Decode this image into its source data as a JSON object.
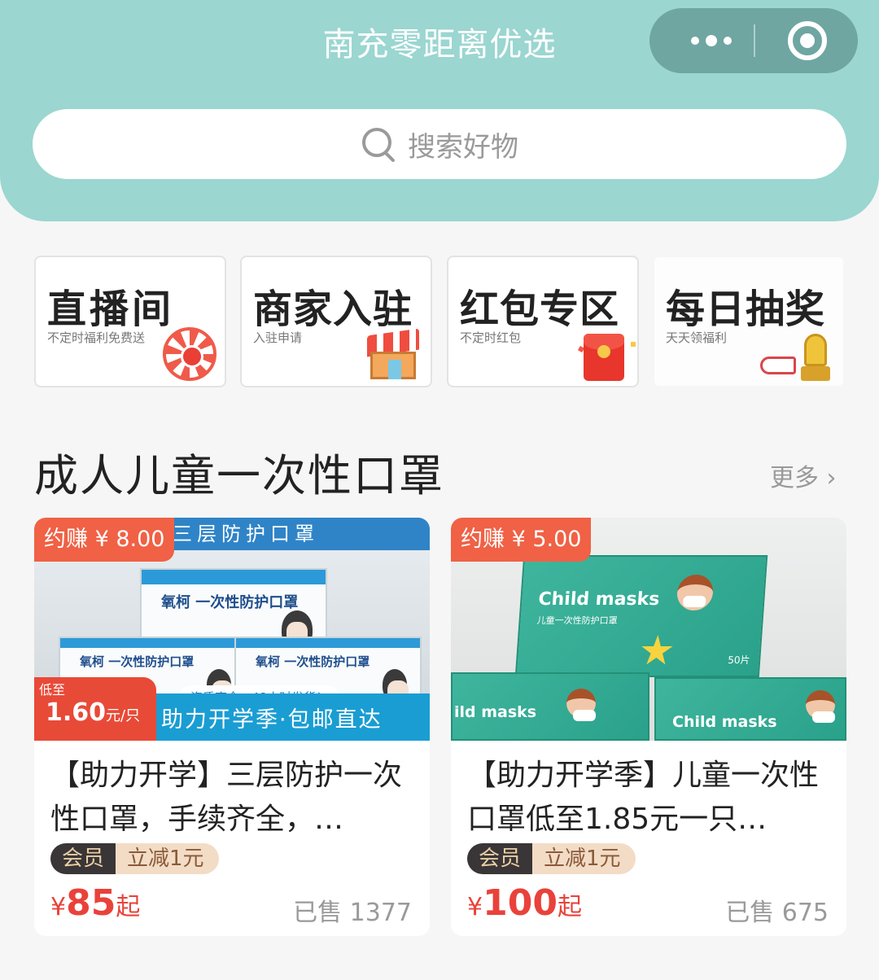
{
  "header": {
    "title": "南充零距离优选",
    "menu_icon": "more-dots-icon",
    "close_icon": "target-circle-icon",
    "search_placeholder": "搜索好物"
  },
  "entries": [
    {
      "title": "直播间",
      "subtitle": "不定时福利免费送",
      "icon": "live-wheel-icon"
    },
    {
      "title": "商家入驻",
      "subtitle": "入驻申请",
      "icon": "shop-icon"
    },
    {
      "title": "红包专区",
      "subtitle": "不定时红包",
      "icon": "red-packet-icon"
    },
    {
      "title": "每日抽奖",
      "subtitle": "天天领福利",
      "icon": "prize-icon"
    }
  ],
  "section": {
    "title": "成人儿童一次性口罩",
    "more_label": "更多",
    "more_icon": "chevron-right-icon"
  },
  "products": [
    {
      "earn_badge": "约赚 ¥ 8.00",
      "photo": {
        "banner": "三层防护口罩",
        "box_text": "一次性防护口罩",
        "box_brand": "氧柯",
        "lowest_label": "低至",
        "lowest_price": "1.60",
        "lowest_unit": "元/只",
        "note": "资质齐全，48小时发货！",
        "slogan": "助力开学季·包邮直达"
      },
      "name": "【助力开学】三层防护一次性口罩，手续齐全，…",
      "tag_member": "会员",
      "tag_discount": "立减1元",
      "price_currency": "¥",
      "price_value": "85",
      "price_suffix": "起",
      "sold": "已售 1377"
    },
    {
      "earn_badge": "约赚 ¥ 5.00",
      "photo": {
        "box_title": "Child masks",
        "box_sub": "儿童一次性防护口罩",
        "box_count": "50片",
        "box_title_2": "ild masks",
        "box_title_3": "Child masks"
      },
      "name": "【助力开学季】儿童一次性口罩低至1.85元一只…",
      "tag_member": "会员",
      "tag_discount": "立减1元",
      "price_currency": "¥",
      "price_value": "100",
      "price_suffix": "起",
      "sold": "已售 675"
    }
  ],
  "colors": {
    "header_bg": "#9bd6d1",
    "capsule_bg": "#6fa6a2",
    "earn_badge": "#f06145",
    "price": "#e9423a",
    "member_tag": "#3a3536",
    "discount_tag": "#f3dcc6"
  }
}
